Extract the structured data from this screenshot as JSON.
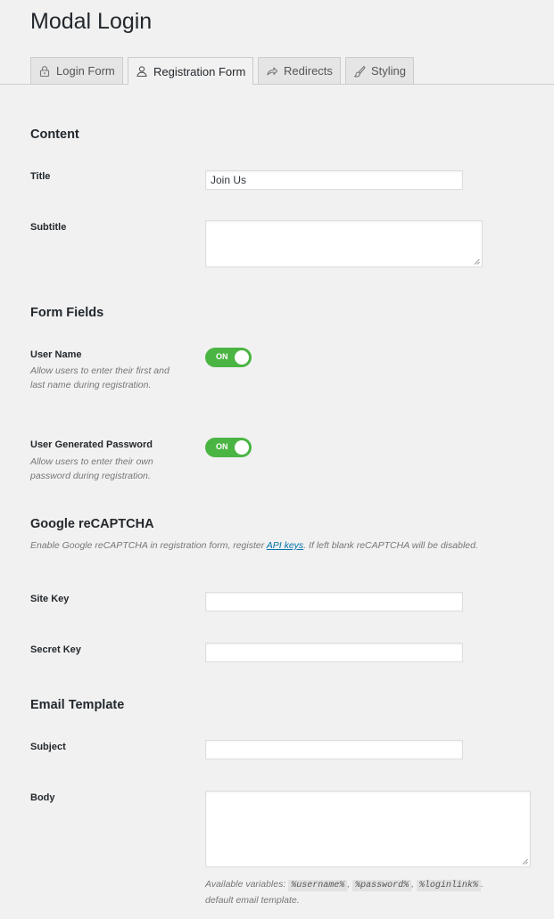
{
  "page": {
    "title": "Modal Login"
  },
  "tabs": [
    {
      "label": "Login Form",
      "icon": "lock-icon",
      "active": false
    },
    {
      "label": "Registration Form",
      "icon": "user-icon",
      "active": true
    },
    {
      "label": "Redirects",
      "icon": "share-arrow-icon",
      "active": false
    },
    {
      "label": "Styling",
      "icon": "brush-icon",
      "active": false
    }
  ],
  "content": {
    "heading": "Content",
    "title_label": "Title",
    "title_value": "Join Us",
    "subtitle_label": "Subtitle",
    "subtitle_value": ""
  },
  "form_fields": {
    "heading": "Form Fields",
    "user_name": {
      "label": "User Name",
      "description": "Allow users to enter their first and last name during registration.",
      "toggle": "ON"
    },
    "user_password": {
      "label": "User Generated Password",
      "description": "Allow users to enter their own password during registration.",
      "toggle": "ON"
    }
  },
  "recaptcha": {
    "heading": "Google reCAPTCHA",
    "help_before": "Enable Google reCAPTCHA in registration form, register ",
    "help_link": "API keys",
    "help_after": ". If left blank reCAPTCHA will be disabled.",
    "site_key_label": "Site Key",
    "site_key_value": "",
    "secret_key_label": "Secret Key",
    "secret_key_value": ""
  },
  "email_template": {
    "heading": "Email Template",
    "subject_label": "Subject",
    "subject_value": "",
    "body_label": "Body",
    "body_value": "",
    "vars_prefix": "Available variables: ",
    "var_1": "%username%",
    "var_2": "%password%",
    "var_3": "%loginlink%",
    "vars_suffix": "default email template."
  },
  "colors": {
    "toggle_on": "#4bb543",
    "link": "#0073aa",
    "background": "#f1f1f1"
  }
}
